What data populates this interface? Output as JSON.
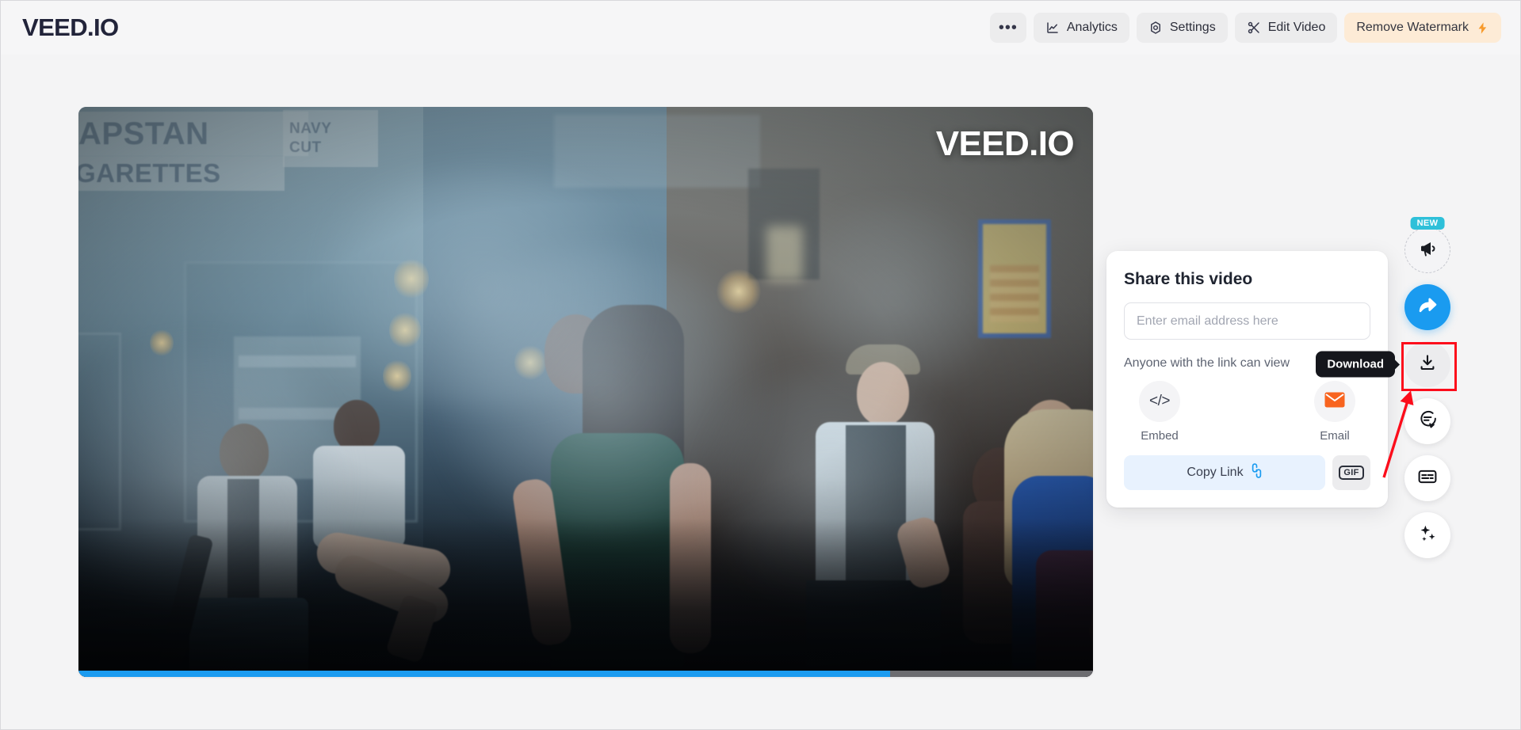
{
  "header": {
    "brand": "VEED.IO",
    "buttons": [
      {
        "label": "",
        "icon": "more-horizontal-icon",
        "glyph": "•••",
        "style": "icon-only"
      },
      {
        "label": "Analytics",
        "icon": "analytics-chart-icon",
        "style": "default"
      },
      {
        "label": "Settings",
        "icon": "gear-icon",
        "style": "default"
      },
      {
        "label": "Edit Video",
        "icon": "scissors-icon",
        "style": "default"
      },
      {
        "label": "Remove Watermark",
        "icon": "lightning-bolt-icon",
        "style": "watermark"
      }
    ]
  },
  "video": {
    "watermark_text": "VEED.IO",
    "progress_percent": 80,
    "signage": {
      "brand": "APSTAN",
      "line_navy": "NAVY",
      "line_cut": "CUT",
      "line_cigarettes": "GARETTES"
    }
  },
  "share_panel": {
    "title": "Share this video",
    "email_placeholder": "Enter email address here",
    "email_value": "",
    "permission_text": "Anyone with the link can view",
    "options": [
      {
        "label": "Embed",
        "icon": "embed-code-icon",
        "glyph": "</>"
      },
      {
        "label": "Email",
        "icon": "email-envelope-icon"
      }
    ],
    "copy_link_label": "Copy Link",
    "copy_link_icon": "link-chain-icon",
    "gif_label": "GIF"
  },
  "rail": {
    "new_badge": "NEW",
    "items": [
      {
        "name": "announcements-button",
        "icon": "megaphone-icon",
        "style": "dashed",
        "badge": "NEW"
      },
      {
        "name": "share-button",
        "icon": "share-arrow-icon",
        "style": "primary"
      },
      {
        "name": "download-button",
        "icon": "download-icon",
        "style": "soft",
        "tooltip": "Download"
      },
      {
        "name": "comments-button",
        "icon": "comment-bubble-icon",
        "style": "white"
      },
      {
        "name": "subtitles-button",
        "icon": "subtitles-icon",
        "style": "white"
      },
      {
        "name": "magic-tools-button",
        "icon": "sparkles-icon",
        "style": "white"
      }
    ]
  },
  "annotations": {
    "highlight_color": "#fc0d1b",
    "highlight_target": "download-button",
    "arrow_color": "#fc0d1b"
  },
  "colors": {
    "page_bg": "#f4f4f5",
    "accent_blue": "#1a9bf0",
    "badge_teal": "#2ec0d9",
    "watermark_btn_bg": "#fdebd6",
    "bolt_orange": "#f79a2b",
    "email_orange": "#f8641f",
    "brand_navy": "#22243a"
  }
}
